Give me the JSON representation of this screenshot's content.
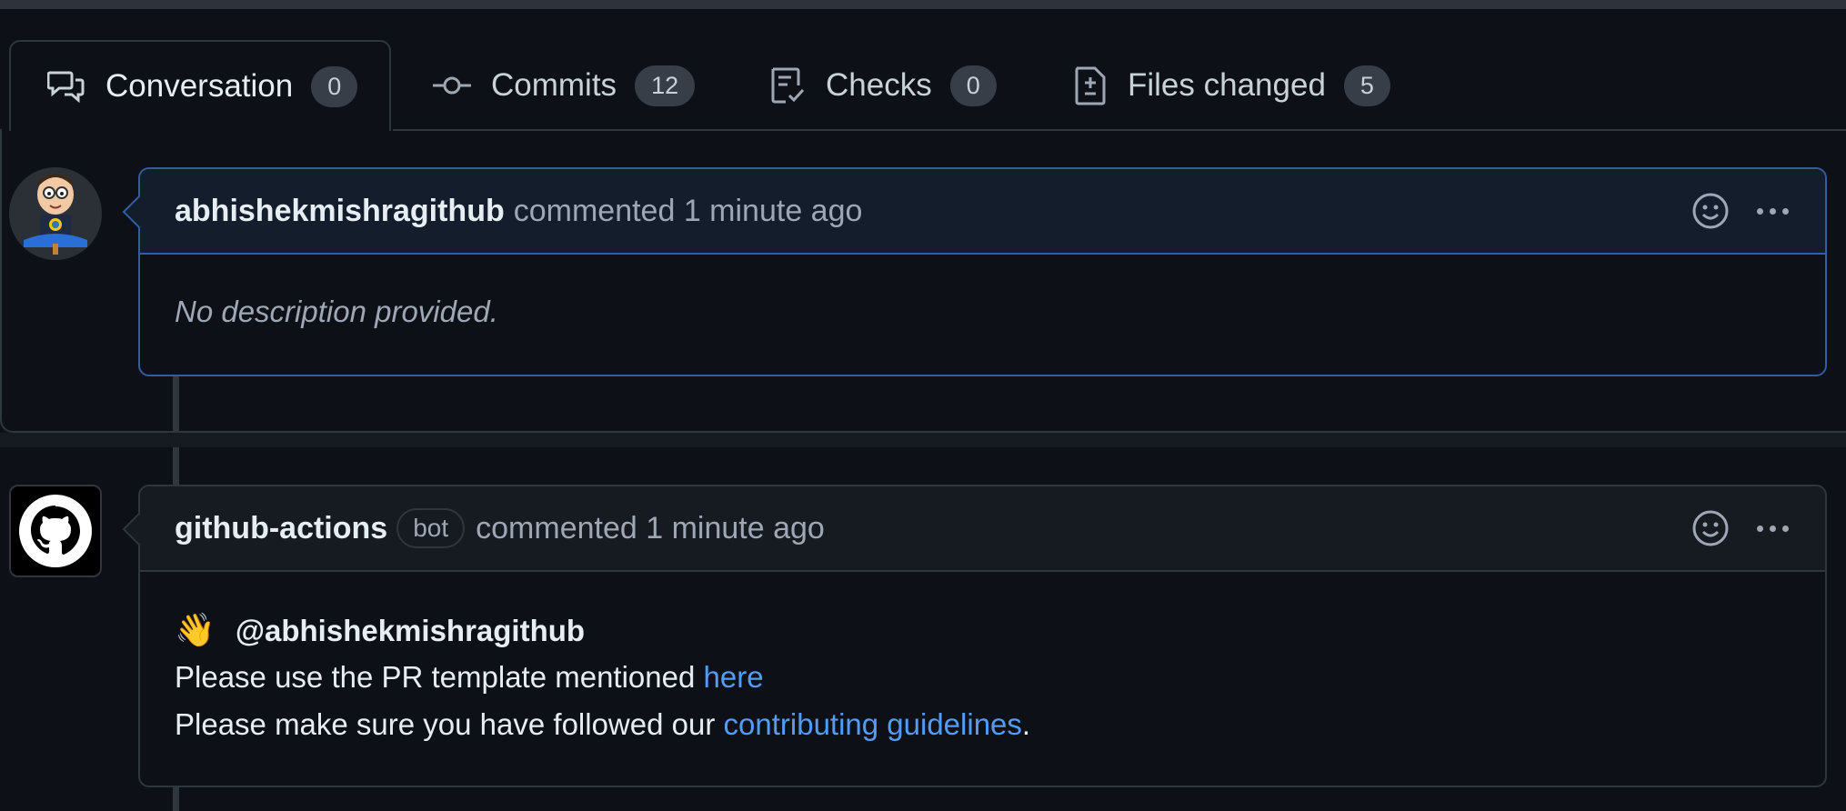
{
  "tabs": [
    {
      "label": "Conversation",
      "count": "0",
      "icon": "conversation-icon",
      "active": true
    },
    {
      "label": "Commits",
      "count": "12",
      "icon": "commit-icon"
    },
    {
      "label": "Checks",
      "count": "0",
      "icon": "checklist-icon"
    },
    {
      "label": "Files changed",
      "count": "5",
      "icon": "file-diff-icon"
    }
  ],
  "comments": [
    {
      "author": "abhishekmishragithub",
      "meta": "commented 1 minute ago",
      "body": "No description provided."
    },
    {
      "author": "github-actions",
      "badge": "bot",
      "meta": "commented 1 minute ago",
      "wave": "👋",
      "mention": "@abhishekmishragithub",
      "line1_text": "Please use the PR template mentioned ",
      "line1_link": "here",
      "line2_text": "Please make sure you have followed our ",
      "line2_link": "contributing guidelines",
      "line2_end": "."
    }
  ],
  "colors": {
    "background": "#0d1117",
    "border": "#30363d",
    "highlight_border": "#2f5ea3",
    "link": "#539bf5",
    "muted": "#9ea7b3"
  }
}
